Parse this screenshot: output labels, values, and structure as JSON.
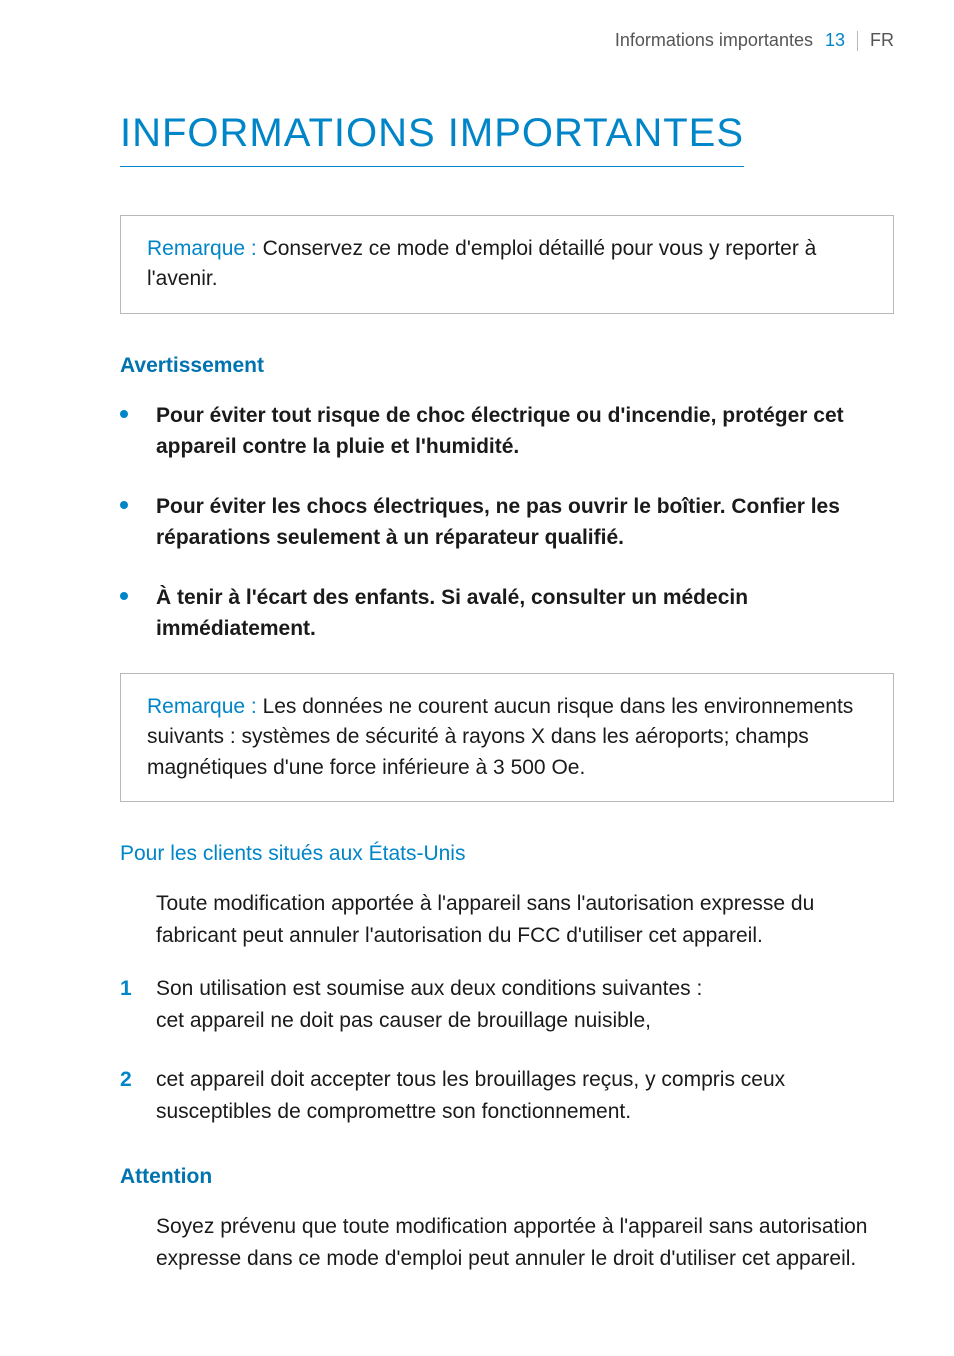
{
  "header": {
    "section_name": "Informations importantes",
    "page_number": "13",
    "lang": "FR"
  },
  "title": "INFORMATIONS IMPORTANTES",
  "note1": {
    "label": "Remarque :",
    "text": "Conservez ce mode d'emploi détaillé pour vous y reporter à l'avenir."
  },
  "warning": {
    "heading": "Avertissement",
    "items": [
      "Pour éviter tout risque de choc électrique ou d'incendie, protéger cet appareil contre la pluie et l'humidité.",
      "Pour éviter les chocs électriques, ne pas ouvrir le boîtier. Confier les réparations seulement à un réparateur qualifié.",
      "À tenir à l'écart des enfants. Si avalé, consulter un médecin immédiatement."
    ]
  },
  "note2": {
    "label": "Remarque :",
    "text": "Les données ne courent aucun risque dans les environnements suivants : systèmes de sécurité à rayons X dans les aéroports; champs magnétiques d'une force inférieure à 3 500 Oe."
  },
  "us_clients": {
    "heading": "Pour les clients situés aux États-Unis",
    "paragraph": "Toute modification apportée à l'appareil sans l'autorisation expresse du fabricant peut annuler l'autorisation du FCC d'utiliser cet appareil.",
    "list_intro": "Son utilisation est soumise aux deux conditions suivantes :",
    "items": [
      "cet appareil ne doit pas causer de brouillage nuisible,",
      "cet appareil doit accepter tous les brouillages reçus, y compris ceux susceptibles de compromettre son fonctionnement."
    ]
  },
  "attention": {
    "heading": "Attention",
    "paragraph": "Soyez prévenu que toute modification apportée à l'appareil sans autorisation expresse dans ce mode d'emploi peut annuler le droit d'utiliser cet appareil."
  }
}
